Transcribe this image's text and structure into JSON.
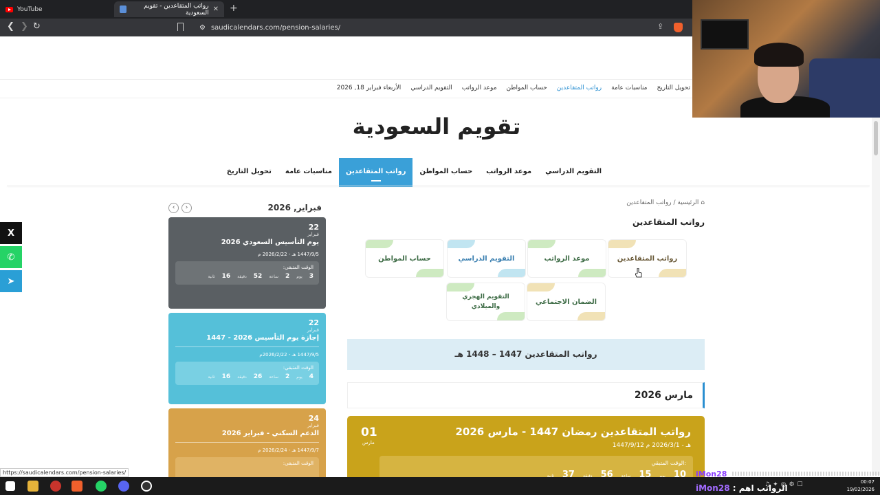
{
  "browser": {
    "tabs": [
      {
        "label": "YouTube",
        "icon": "youtube-icon"
      },
      {
        "label": "رواتب المتقاعدين - تقويم السعودية",
        "icon": "site-icon"
      }
    ],
    "url": "saudicalendars.com/pension-salaries/",
    "status_url": "https://saudicalendars.com/pension-salaries/"
  },
  "topbar": {
    "date": "الأربعاء فبراير 18, 2026",
    "links": [
      "التقويم الدراسي",
      "موعد الرواتب",
      "حساب المواطن",
      "رواتب المتقاعدين",
      "مناسبات عامة",
      "تحويل التاريخ"
    ],
    "active_index": 3
  },
  "site": {
    "title": "تقويم السعودية"
  },
  "mainnav": {
    "items": [
      "التقويم الدراسي",
      "موعد الرواتب",
      "حساب المواطن",
      "رواتب المتقاعدين",
      "مناسبات عامة",
      "تحويل التاريخ"
    ],
    "active_index": 3
  },
  "social": {
    "x": "X",
    "whatsapp": "✆",
    "telegram": "➤"
  },
  "calendar": {
    "month": "فبراير, 2026",
    "events": [
      {
        "day": "22",
        "month": "فبراير",
        "title": "يوم التأسيس السعودي 2026",
        "date": "1447/9/5 هـ - 2026/2/22 م",
        "countdown_label": "الوقت المتبقي:",
        "counts": {
          "days": "3",
          "hours": "2",
          "minutes": "52",
          "seconds": "16"
        },
        "color": "#5a5f63"
      },
      {
        "day": "22",
        "month": "فبراير",
        "title": "إجازة يوم التأسيس 2026 - 1447",
        "date": "1447/9/5 هـ - 2026/2/22م",
        "countdown_label": "الوقت المتبقي:",
        "counts": {
          "days": "4",
          "hours": "2",
          "minutes": "26",
          "seconds": "16"
        },
        "color": "#55c0d9"
      },
      {
        "day": "24",
        "month": "فبراير",
        "title": "الدعم السكني - فبراير 2026",
        "date": "1447/9/7 هـ - 2026/2/24 م",
        "countdown_label": "الوقت المتبقي:",
        "color": "#d7a24a"
      }
    ],
    "units": {
      "days": "يوم",
      "hours": "ساعة",
      "minutes": "دقيقة",
      "seconds": "ثانية"
    }
  },
  "breadcrumb": {
    "home": "الرئيسية",
    "sep": "/",
    "current": "رواتب المتقاعدين"
  },
  "section": {
    "title": "رواتب المتقاعدين"
  },
  "quicklinks": [
    "رواتب المتقاعدين",
    "موعد الرواتب",
    "التقويم الدراسي",
    "حساب المواطن",
    "الضمان الاجتماعي",
    "التقويم الهجري والميلادي"
  ],
  "banner": {
    "text": "رواتب المتقاعدين 1447 – 1448 هـ"
  },
  "month_header": {
    "text": "مارس 2026"
  },
  "gold_event": {
    "day": "01",
    "month": "مارس",
    "title": "رواتب المتقاعدين رمضان 1447 - مارس 2026",
    "date": "1447/9/12 هـ - 2026/3/1 م",
    "countdown_label": "الوقت المتبقي:",
    "counts": {
      "days": "10",
      "hours": "15",
      "minutes": "56",
      "seconds": "37"
    }
  },
  "stream": {
    "chat_user": "iMon28",
    "chat_text": "الرواتب اهم :",
    "clock_time": "00:07",
    "clock_date": "19/02/2026"
  }
}
